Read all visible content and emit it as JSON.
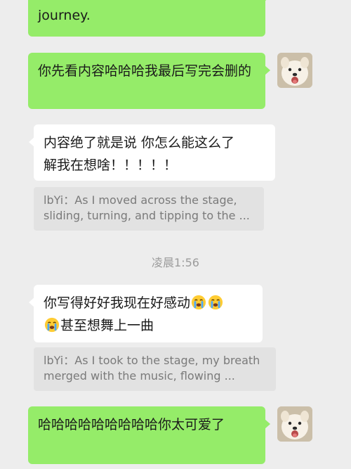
{
  "messages": {
    "top_partial": "journey.",
    "msg1": "你先看内容哈哈哈我最后写完会删的",
    "msg2_line1": "内容绝了就是说 你怎么能这么了",
    "msg2_line2": "解我在想啥！！！！！",
    "quote1_line1": "lbYi：As I moved across the stage,",
    "quote1_line2": "sliding, turning, and tipping to the ...",
    "timestamp": "凌晨1:56",
    "msg3_line1": "你写得好好我现在好感动",
    "msg3_line2": "甚至想舞上一曲",
    "quote2_line1": "lbYi：As I took to the stage, my breath",
    "quote2_line2": "merged with the music, flowing ...",
    "msg4": "哈哈哈哈哈哈哈哈哈你太可爱了"
  },
  "icons": {
    "avatar": "samoyed-puppy-avatar",
    "emoji": "loudly-crying-face-emoji"
  },
  "colors": {
    "background": "#ededed",
    "sent_bubble": "#95ec69",
    "received_bubble": "#ffffff",
    "quote_bg": "#e2e2e2"
  }
}
